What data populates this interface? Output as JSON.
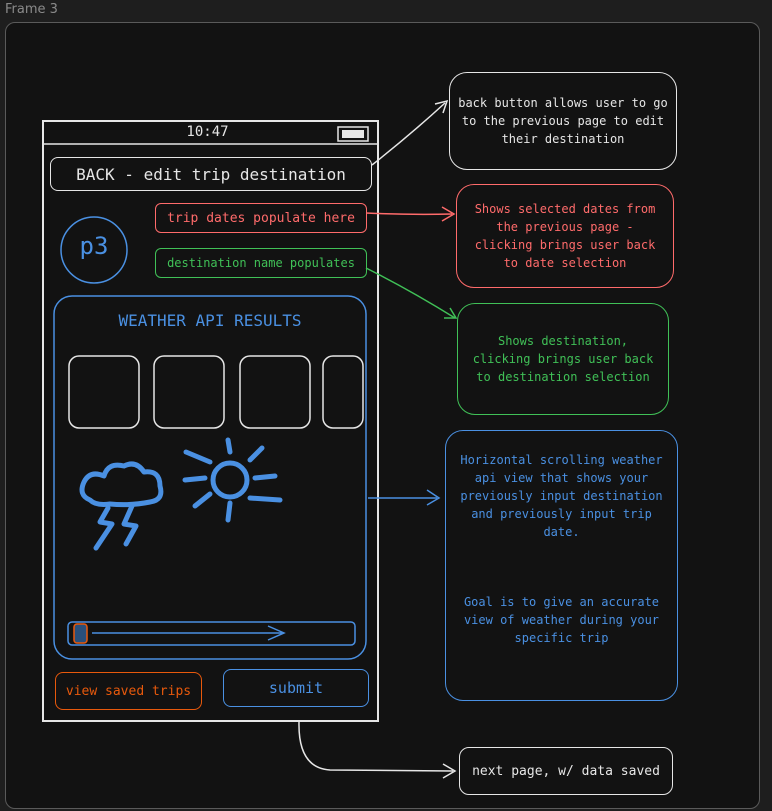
{
  "frame": {
    "label": "Frame 3"
  },
  "phone": {
    "time": "10:47",
    "back_label": "BACK - edit trip destination",
    "avatar_label": "p3",
    "dates_label": "trip dates populate here",
    "destination_label": "destination name populates",
    "weather_title": "WEATHER API RESULTS",
    "saved_trips_label": "view saved trips",
    "submit_label": "submit"
  },
  "notes": {
    "back": "back button allows user to go to the previous page to edit their destination",
    "dates": "Shows selected dates from the previous page - clicking brings user back to date selection",
    "destination": "Shows destination, clicking brings user back to destination selection",
    "weather_p1": "Horizontal scrolling weather api view that shows your previously input destination and previously input trip date.",
    "weather_p2": "Goal is to give an accurate view of weather during your specific trip",
    "next": "next page, w/ data saved"
  },
  "colors": {
    "white": "#e6e6e6",
    "red": "#ff6b6b",
    "green": "#40c057",
    "blue": "#4a90e2",
    "orange": "#e8590c"
  }
}
